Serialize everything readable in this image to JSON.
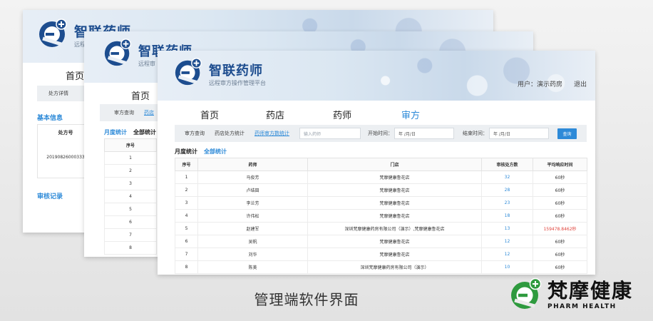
{
  "windows": {
    "back": {
      "logo_title": "智联药师",
      "logo_sub": "远程",
      "nav_home": "首页",
      "tab": "处方详情",
      "section_basic": "基本信息",
      "field_label": "处方号",
      "field_value": "20190826000333",
      "section_audit": "审核记录"
    },
    "middle": {
      "logo_title": "智联药师",
      "logo_sub": "远程审",
      "nav_home": "首页",
      "tool_tab1": "审方查询",
      "tool_tab2": "药店",
      "subtab1": "月度统计",
      "subtab2": "全部统计",
      "col_index": "序号",
      "rows": [
        "1",
        "2",
        "3",
        "4",
        "5",
        "6",
        "7",
        "8"
      ]
    },
    "front": {
      "logo_title": "智联药师",
      "logo_sub": "远程审方操作管理平台",
      "user_label": "用户：演示药房",
      "logout_label": "退出",
      "nav": [
        "首页",
        "药店",
        "药师",
        "审方"
      ],
      "nav_active_index": 3,
      "tool_tabs": [
        "审方查询",
        "药店处方统计",
        "药师审方数统计"
      ],
      "tool_active_index": 2,
      "search_placeholder": "输入药师",
      "start_label": "开始时间：",
      "start_placeholder": "年 /月/日",
      "end_label": "结束时间：",
      "end_placeholder": "年 /月/日",
      "query_button": "查询",
      "subtab1": "月度统计",
      "subtab2": "全部统计",
      "columns": [
        "序号",
        "药师",
        "门店",
        "审核处方数",
        "平均响应时间"
      ],
      "rows": [
        {
          "idx": "1",
          "name": "马俊芳",
          "store": "梵摩健康鲁花店",
          "count": "32",
          "time": "60秒",
          "alert": false
        },
        {
          "idx": "2",
          "name": "卢结田",
          "store": "梵摩健康鲁花店",
          "count": "28",
          "time": "60秒",
          "alert": false
        },
        {
          "idx": "3",
          "name": "李兰芳",
          "store": "梵摩健康鲁花店",
          "count": "23",
          "time": "60秒",
          "alert": false
        },
        {
          "idx": "4",
          "name": "许伟松",
          "store": "梵摩健康鲁花店",
          "count": "18",
          "time": "60秒",
          "alert": false
        },
        {
          "idx": "5",
          "name": "赵建军",
          "store": "深圳梵摩健康药房有限公司（演示）,梵摩健康鲁花店",
          "count": "13",
          "time": "159478.8462秒",
          "alert": true
        },
        {
          "idx": "6",
          "name": "吴帆",
          "store": "梵摩健康鲁花店",
          "count": "12",
          "time": "60秒",
          "alert": false
        },
        {
          "idx": "7",
          "name": "刘华",
          "store": "梵摩健康鲁花店",
          "count": "12",
          "time": "60秒",
          "alert": false
        },
        {
          "idx": "8",
          "name": "陈美",
          "store": "深圳梵摩健康药房有限公司（演示）",
          "count": "10",
          "time": "60秒",
          "alert": false
        }
      ]
    }
  },
  "caption": "管理端软件界面",
  "brand": {
    "name_cn": "梵摩健康",
    "name_en": "PHARM HEALTH"
  },
  "colors": {
    "accent": "#2d8ad8",
    "alert": "#e0443c",
    "brand_green": "#2e9a3e",
    "logo_blue": "#1d4d8f"
  }
}
